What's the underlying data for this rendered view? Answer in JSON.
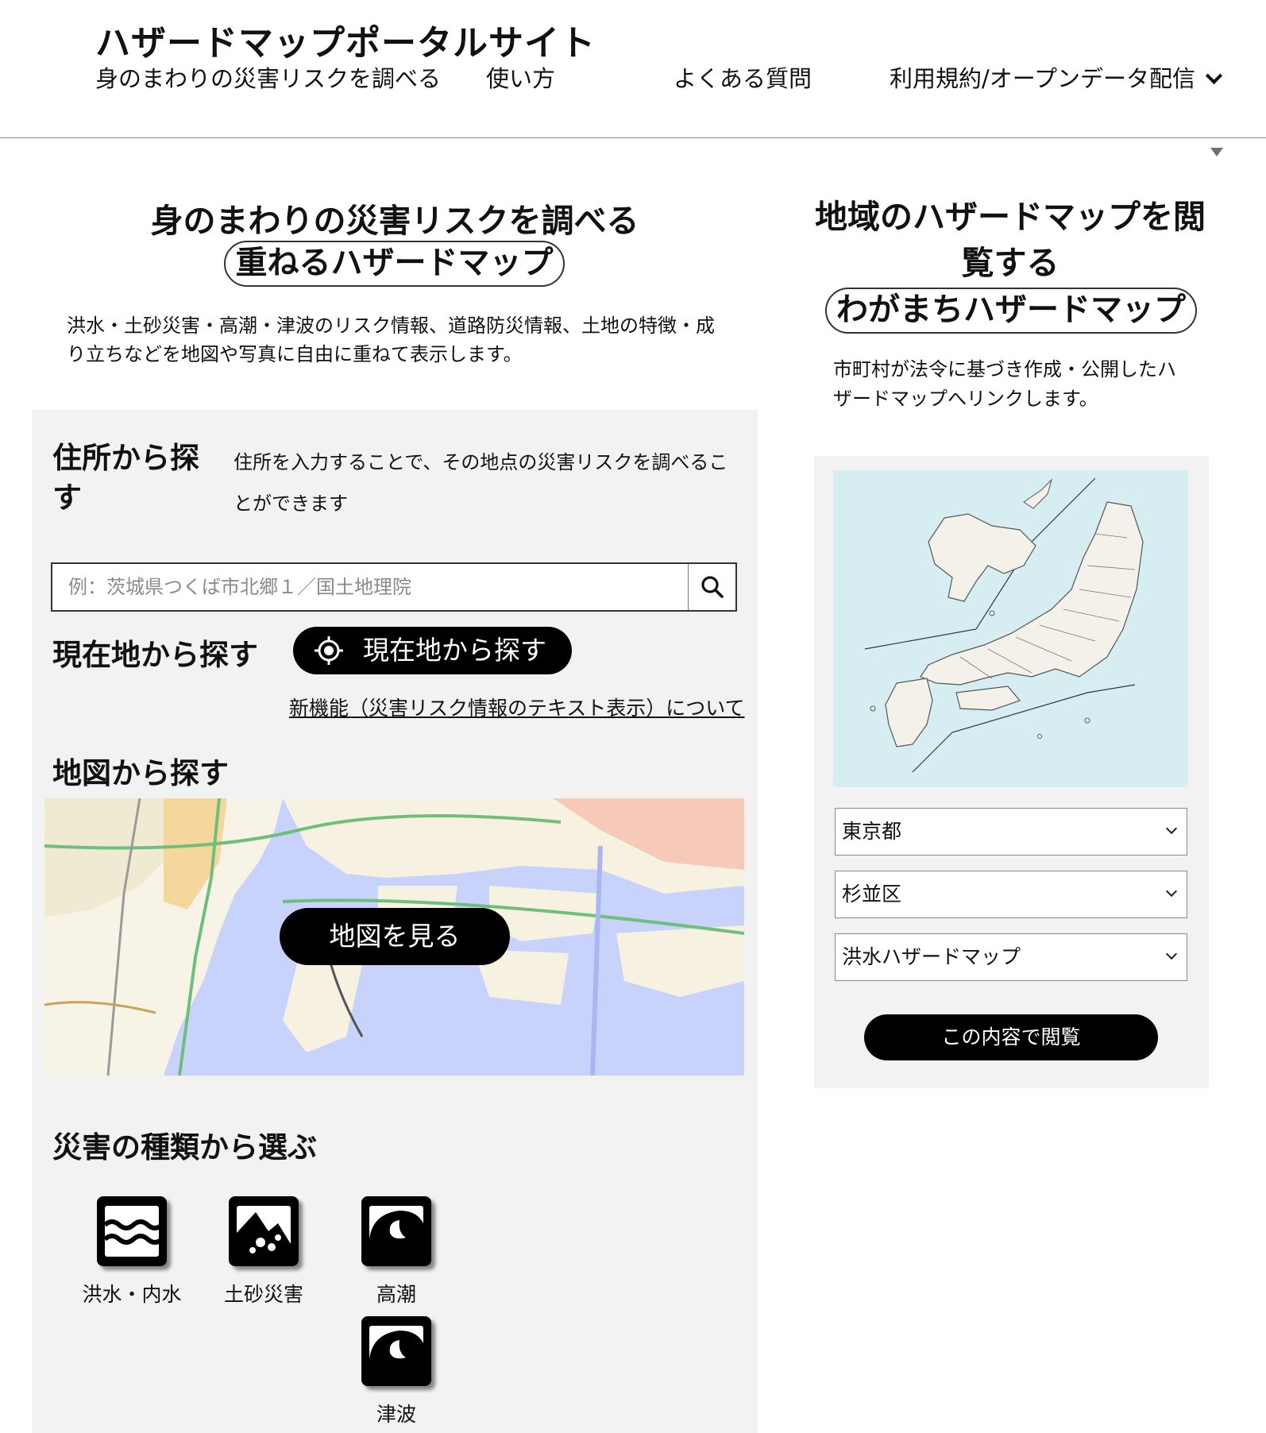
{
  "header": {
    "site_title": "ハザードマップポータルサイト",
    "nav": [
      {
        "label": "身のまわりの災害リスクを調べる"
      },
      {
        "label": "使い方"
      },
      {
        "label": "よくある質問"
      },
      {
        "label": "利用規約/オープンデータ配信"
      }
    ]
  },
  "left": {
    "title": "身のまわりの災害リスクを調べる",
    "pill": "重ねるハザードマップ",
    "description": "洪水・土砂災害・高潮・津波のリスク情報、道路防災情報、土地の特徴・成り立ちなどを地図や写真に自由に重ねて表示します。",
    "address_heading": "住所から探す",
    "address_description": "住所を入力することで、その地点の災害リスクを調べることができます",
    "search_placeholder": "例：茨城県つくば市北郷１／国土地理院",
    "current_heading": "現在地から探す",
    "current_button": "現在地から探す",
    "new_feature_link": "新機能（災害リスク情報のテキスト表示）について",
    "map_heading": "地図から探す",
    "map_button": "地図を見る",
    "type_heading": "災害の種類から選ぶ",
    "hazards": [
      {
        "label": "洪水・内水",
        "icon": "flood-icon"
      },
      {
        "label": "土砂災害",
        "icon": "landslide-icon"
      },
      {
        "label": "高潮",
        "icon": "storm-surge-icon"
      },
      {
        "label": "津波",
        "icon": "tsunami-icon"
      }
    ]
  },
  "right": {
    "title": "地域のハザードマップを閲覧する",
    "pill": "わがまちハザードマップ",
    "description": "市町村が法令に基づき作成・公開したハザードマップへリンクします。",
    "prefecture": "東京都",
    "city": "杉並区",
    "map_type": "洪水ハザードマップ",
    "view_button": "この内容で閲覧"
  },
  "colors": {
    "button_bg": "#000000",
    "panel_bg": "#f2f2f2",
    "sea_blue": "#c7d3fb",
    "japan_sea": "#d6edf2"
  }
}
